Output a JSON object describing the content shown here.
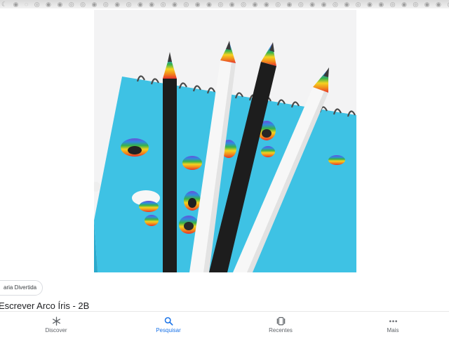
{
  "image": {
    "alt": ""
  },
  "chip": {
    "label": "aria Divertida"
  },
  "result": {
    "title": "Escrever Arco Íris - 2B"
  },
  "nav": {
    "items": [
      {
        "label": "Discover",
        "icon": "asterisk-icon",
        "active": false
      },
      {
        "label": "Pesquisar",
        "icon": "search-icon",
        "active": true
      },
      {
        "label": "Recentes",
        "icon": "recent-tabs-icon",
        "active": false
      },
      {
        "label": "Mais",
        "icon": "more-horiz-icon",
        "active": false
      }
    ]
  },
  "colors": {
    "accent": "#1a73e8",
    "notebook": "#3fc0e2",
    "text": "#202124"
  }
}
